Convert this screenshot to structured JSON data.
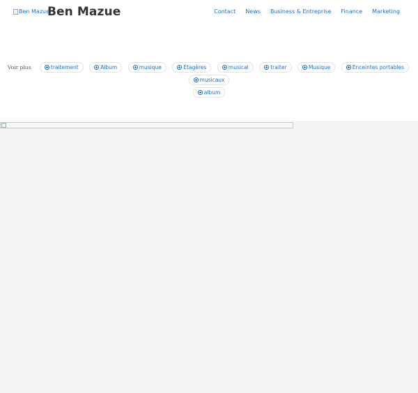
{
  "header": {
    "logo_alt": "Ben Mazue",
    "site_title": "Ben Mazue",
    "nav": [
      "Contact",
      "News",
      "Business & Entreprise",
      "Finance",
      "Marketing"
    ]
  },
  "tags": {
    "label": "Voir plus",
    "items": [
      "traitement",
      "Album",
      "musique",
      "Étagères",
      "musical",
      "traiter",
      "Musique",
      "Enceintes portables",
      "musicaux",
      "album"
    ]
  },
  "colors": {
    "link": "#1a6fcf",
    "title": "#333333",
    "background": "#f4f4f4"
  }
}
